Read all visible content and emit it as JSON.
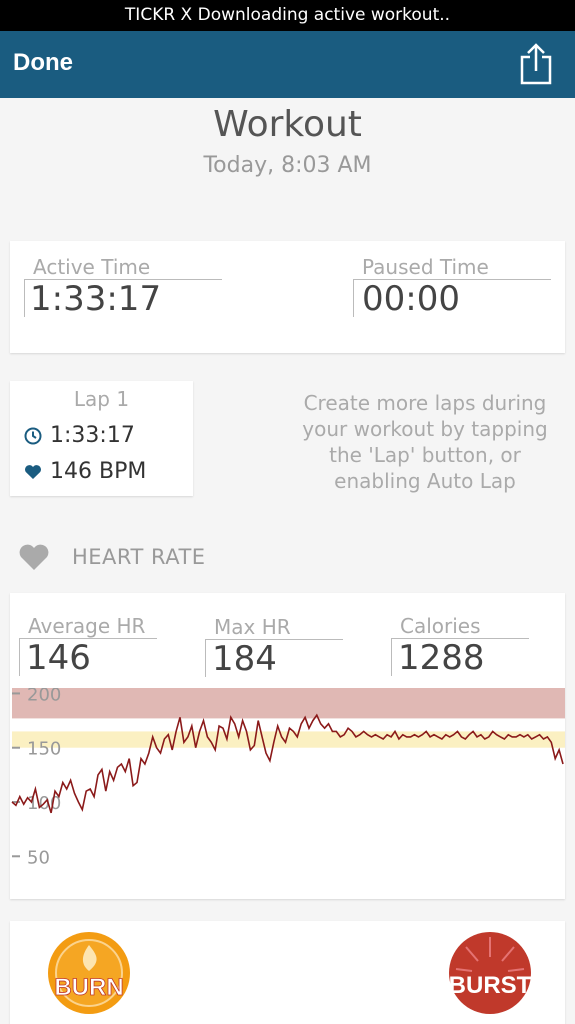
{
  "status_bar": {
    "text": "TICKR X Downloading active workout.."
  },
  "nav": {
    "done_label": "Done",
    "share_icon": "share-icon"
  },
  "header": {
    "title": "Workout",
    "subtitle": "Today, 8:03 AM"
  },
  "time_card": {
    "active_label": "Active Time",
    "active_value": "1:33:17",
    "paused_label": "Paused Time",
    "paused_value": "00:00"
  },
  "lap": {
    "title": "Lap 1",
    "time": "1:33:17",
    "bpm": "146 BPM",
    "hint": "Create more laps during your workout by tapping the 'Lap' button, or enabling Auto Lap"
  },
  "heart_rate_section": {
    "label": "HEART RATE"
  },
  "hr_card": {
    "avg_label": "Average HR",
    "avg_value": "146",
    "max_label": "Max HR",
    "max_value": "184",
    "cal_label": "Calories",
    "cal_value": "1288"
  },
  "colors": {
    "nav": "#1a5c80",
    "zone_high": "#e0b8b4",
    "zone_mid": "#fbf0c2",
    "line": "#8b1a1a",
    "burn": "#f39c12",
    "burst": "#c0392b"
  },
  "chart_data": {
    "type": "line",
    "ylim": [
      30,
      205
    ],
    "ticks": [
      "200",
      "150",
      "100",
      "50"
    ],
    "tick_values": [
      200,
      150,
      100,
      50
    ],
    "zones": [
      {
        "from": 177,
        "to": 205,
        "color": "#e0b8b4"
      },
      {
        "from": 150,
        "to": 165,
        "color": "#fbf0c2"
      }
    ],
    "series": [
      {
        "values": [
          100,
          97,
          105,
          98,
          104,
          100,
          112,
          95,
          98,
          102,
          90,
          110,
          105,
          118,
          112,
          120,
          108,
          100,
          93,
          110,
          112,
          105,
          125,
          130,
          110,
          128,
          120,
          132,
          135,
          128,
          140,
          115,
          118,
          140,
          135,
          145,
          160,
          150,
          145,
          158,
          162,
          148,
          165,
          178,
          155,
          160,
          170,
          150,
          165,
          175,
          160,
          155,
          148,
          170,
          168,
          158,
          178,
          172,
          160,
          175,
          165,
          148,
          152,
          175,
          160,
          145,
          138,
          155,
          170,
          160,
          155,
          168,
          165,
          160,
          172,
          178,
          168,
          175,
          180,
          172,
          168,
          172,
          165,
          165,
          160,
          162,
          168,
          165,
          160,
          162,
          165,
          162,
          160,
          162,
          160,
          158,
          162,
          160,
          165,
          158,
          162,
          160,
          160,
          162,
          160,
          162,
          165,
          160,
          162,
          160,
          158,
          162,
          160,
          162,
          165,
          160,
          158,
          162,
          165,
          160,
          162,
          158,
          160,
          165,
          162,
          160,
          158,
          162,
          160,
          160,
          162,
          160,
          162,
          158,
          160,
          162,
          158,
          160,
          155,
          140,
          148,
          135
        ]
      }
    ]
  },
  "badges": {
    "burn_label": "BURN",
    "burst_label": "BURST"
  }
}
